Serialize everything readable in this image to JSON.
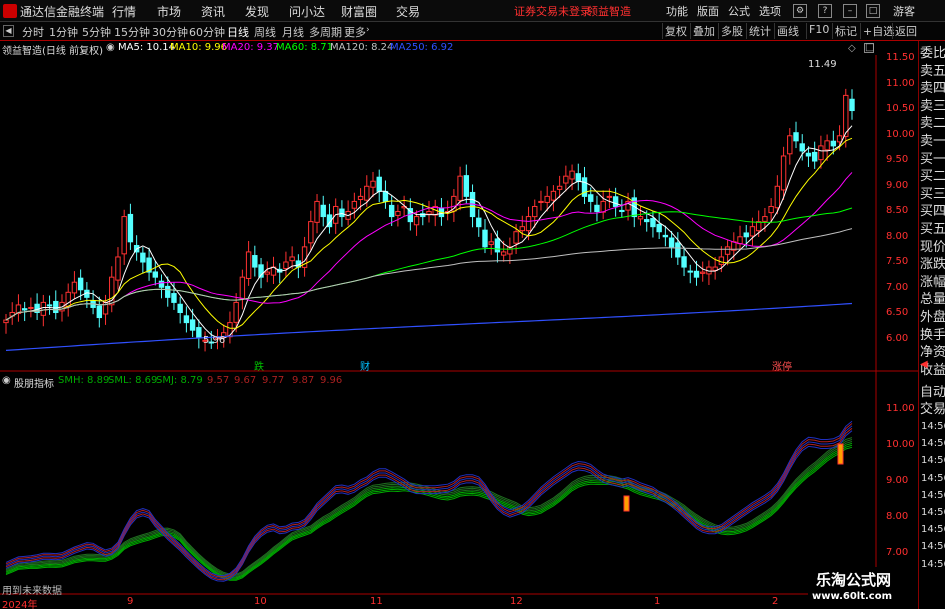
{
  "menubar": {
    "app_name": "通达信金融终端",
    "items": [
      "行情",
      "市场",
      "资讯",
      "发现",
      "问小达",
      "财富圈",
      "交易"
    ],
    "warning": "证券交易未登录",
    "warning2": "领益智造",
    "right_items": [
      "功能",
      "版面",
      "公式",
      "选项"
    ],
    "guest": "游客"
  },
  "toolbar": {
    "periods": [
      "分时",
      "1分钟",
      "5分钟",
      "15分钟",
      "30分钟",
      "60分钟",
      "日线",
      "周线",
      "月线",
      "多周期",
      "更多"
    ],
    "active_period": "日线",
    "right_buttons": [
      "复权",
      "叠加",
      "多股",
      "统计",
      "画线",
      "F10",
      "标记",
      "+自选",
      "返回"
    ]
  },
  "stock": {
    "title": "领益智造(日线 前复权)",
    "ma": [
      {
        "label": "MA5: 10.14",
        "color": "#ffffff"
      },
      {
        "label": "MA10: 9.96",
        "color": "#ffff00"
      },
      {
        "label": "MA20: 9.37",
        "color": "#ff00ff"
      },
      {
        "label": "MA60: 8.71",
        "color": "#00ff00"
      },
      {
        "label": "MA120: 8.24",
        "color": "#c0c0c0"
      },
      {
        "label": "MA250: 6.92",
        "color": "#3050ff"
      }
    ],
    "high_label": "11.49",
    "low_label": "5.96",
    "event_labels": [
      "跌",
      "财",
      "涨停"
    ]
  },
  "indicator": {
    "title": "股朋指标",
    "values": [
      {
        "label": "SMH: 8.89",
        "color": "#00aa00"
      },
      {
        "label": "SML: 8.69",
        "color": "#00aa00"
      },
      {
        "label": "SMJ: 8.79",
        "color": "#00aa00"
      },
      {
        "label": "9.57",
        "color": "#aa2020"
      },
      {
        "label": "9.67",
        "color": "#aa2020"
      },
      {
        "label": "9.77",
        "color": "#aa2020"
      },
      {
        "label": "9.87",
        "color": "#aa2020"
      },
      {
        "label": "9.96",
        "color": "#aa2020"
      }
    ],
    "footer": "用到未来数据"
  },
  "price_axis": [
    "11.50",
    "11.00",
    "10.50",
    "10.00",
    "9.50",
    "9.00",
    "8.50",
    "8.00",
    "7.50",
    "7.00",
    "6.50",
    "6.00"
  ],
  "ind_axis": [
    "11.00",
    "10.00",
    "9.00",
    "8.00",
    "7.00"
  ],
  "x_axis": [
    "2024年",
    "9",
    "10",
    "11",
    "12",
    "1",
    "2"
  ],
  "right_panel": {
    "labels": [
      "委比",
      "卖五",
      "卖四",
      "卖三",
      "卖二",
      "卖一",
      "买一",
      "买二",
      "买三",
      "买四",
      "买五",
      "现价",
      "涨跌",
      "涨幅",
      "总量",
      "外盘",
      "换手",
      "净资",
      "收益"
    ],
    "labels2": [
      "自动",
      "交易"
    ],
    "times": [
      "14:56",
      "14:56",
      "14:56",
      "14:56",
      "14:56",
      "14:56",
      "14:56",
      "14:56",
      "14:56"
    ]
  },
  "watermark": {
    "line1": "乐淘公式网",
    "line2": "www.60lt.com"
  },
  "chart_data": {
    "type": "candlestick",
    "price_range": [
      5.7,
      11.8
    ],
    "closes": [
      6.55,
      6.7,
      6.85,
      6.75,
      6.8,
      6.7,
      6.9,
      6.85,
      6.7,
      6.9,
      7.1,
      7.3,
      7.15,
      7.0,
      6.8,
      6.6,
      6.9,
      7.4,
      7.8,
      8.6,
      8.1,
      7.9,
      7.7,
      7.5,
      7.4,
      7.2,
      7.0,
      6.9,
      6.7,
      6.5,
      6.35,
      6.2,
      6.15,
      6.1,
      6.2,
      6.3,
      6.5,
      6.9,
      7.4,
      7.9,
      7.6,
      7.4,
      7.5,
      7.6,
      7.5,
      7.7,
      7.8,
      7.6,
      8.0,
      8.5,
      8.9,
      8.6,
      8.4,
      8.8,
      8.6,
      8.7,
      8.9,
      9.0,
      9.2,
      9.3,
      9.1,
      8.9,
      8.6,
      8.7,
      8.8,
      8.5,
      8.6,
      8.6,
      8.7,
      8.8,
      8.6,
      8.7,
      9.0,
      9.4,
      9.0,
      8.6,
      8.4,
      8.0,
      8.1,
      7.9,
      7.9,
      8.0,
      8.3,
      8.4,
      8.6,
      8.8,
      8.9,
      9.0,
      9.1,
      9.2,
      9.4,
      9.5,
      9.3,
      9.0,
      8.9,
      8.7,
      8.9,
      9.0,
      8.8,
      8.7,
      8.9,
      8.6,
      8.6,
      8.5,
      8.4,
      8.3,
      8.2,
      8.0,
      7.8,
      7.6,
      7.5,
      7.4,
      7.5,
      7.6,
      7.6,
      7.8,
      8.0,
      8.1,
      8.2,
      8.2,
      8.4,
      8.5,
      8.6,
      8.8,
      9.2,
      9.8,
      10.2,
      10.1,
      9.9,
      9.8,
      9.7,
      10.0,
      10.1,
      10.0,
      10.2,
      11.0,
      10.7
    ]
  }
}
